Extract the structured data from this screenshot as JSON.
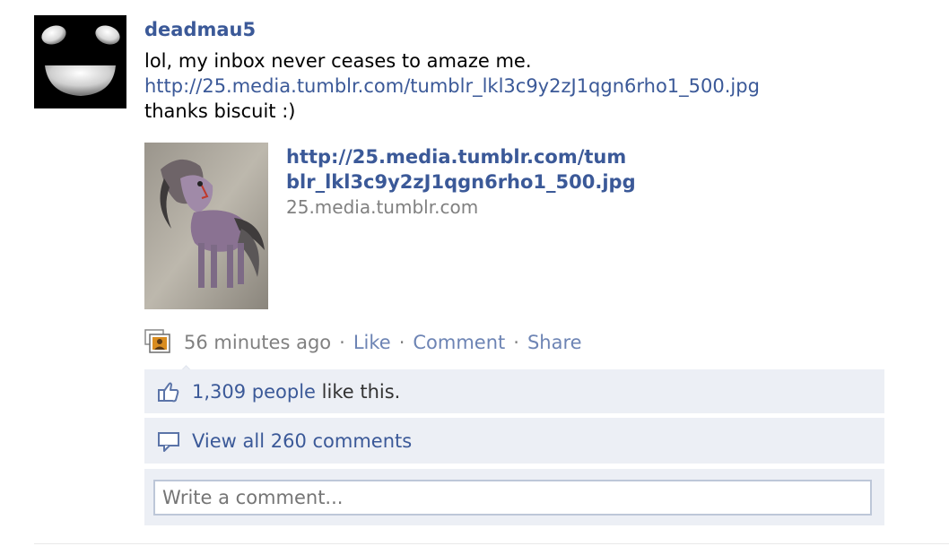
{
  "post": {
    "author": "deadmau5",
    "message_lines": [
      "lol, my inbox never ceases to amaze me.",
      "http://25.media.tumblr.com/tumblr_lkl3c9y2zJ1qgn6rho1_500.jpg",
      "thanks biscuit :)"
    ],
    "attachment": {
      "title_line1": "http://25.media.tumblr.com/tum",
      "title_line2": "blr_lkl3c9y2zJ1qgn6rho1_500.jpg",
      "caption": "25.media.tumblr.com"
    },
    "meta": {
      "time": "56 minutes ago",
      "separator": "·",
      "like": "Like",
      "comment": "Comment",
      "share": "Share"
    }
  },
  "ufi": {
    "likes_count_link": "1,309 people",
    "likes_suffix": "like this.",
    "view_comments": "View all 260 comments",
    "comment_placeholder": "Write a comment..."
  },
  "colors": {
    "link": "#3b5998",
    "secondary_link": "#6d84b4",
    "panel": "#eceff5",
    "input_border": "#bdc7d8"
  },
  "icons": [
    "deadmau5-avatar",
    "stream-photo-icon",
    "thumbs-up-icon",
    "comment-bubble-icon"
  ]
}
